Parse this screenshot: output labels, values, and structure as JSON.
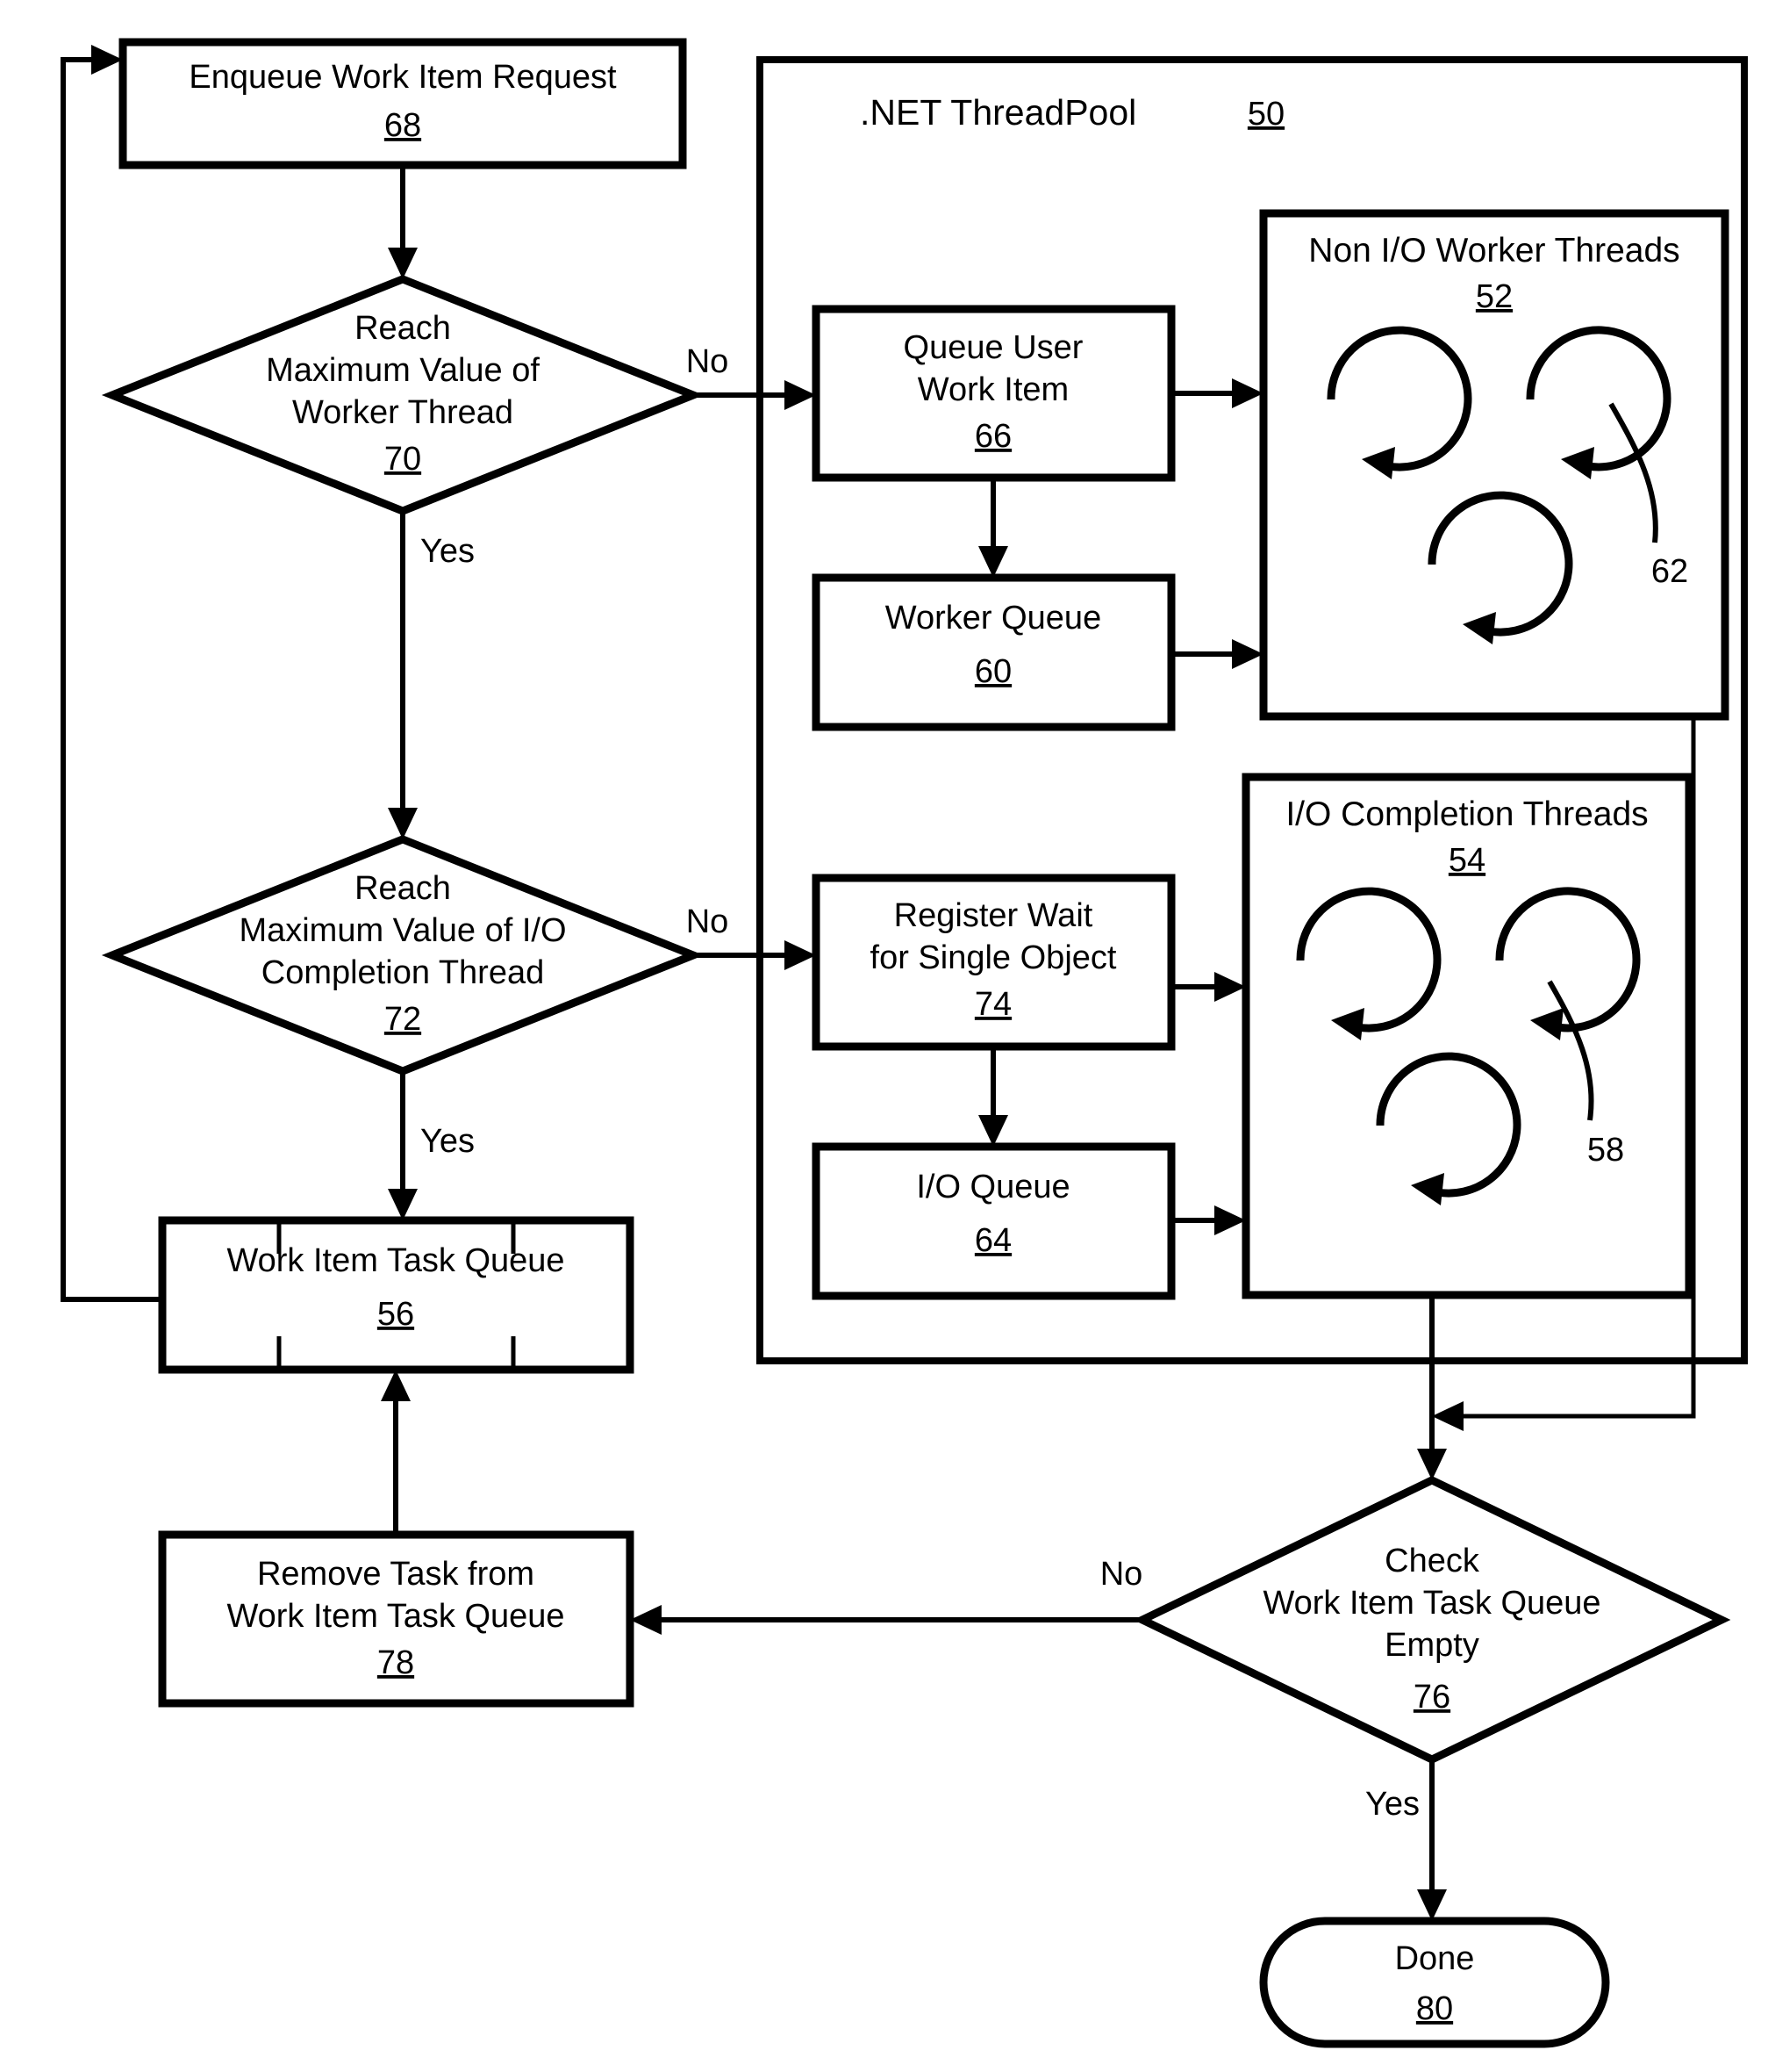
{
  "figure": {
    "kind": "patent-flowchart",
    "title": ".NET ThreadPool work item dispatch flow"
  },
  "container": {
    "label": ".NET ThreadPool",
    "ref": "50"
  },
  "nodes": {
    "enqueue": {
      "line1": "Enqueue Work Item Request",
      "ref": "68"
    },
    "decision_worker": {
      "line1": "Reach",
      "line2": "Maximum Value of",
      "line3": "Worker Thread",
      "ref": "70"
    },
    "decision_io": {
      "line1": "Reach",
      "line2": "Maximum Value of I/O",
      "line3": "Completion Thread",
      "ref": "72"
    },
    "queue_user_work_item": {
      "line1": "Queue User",
      "line2": "Work Item",
      "ref": "66"
    },
    "worker_queue": {
      "line1": "Worker Queue",
      "ref": "60"
    },
    "register_wait": {
      "line1": "Register Wait",
      "line2": "for Single Object",
      "ref": "74"
    },
    "io_queue": {
      "line1": "I/O Queue",
      "ref": "64"
    },
    "non_io_worker_threads": {
      "line1": "Non I/O Worker Threads",
      "ref": "52",
      "thread_ref": "62"
    },
    "io_completion_threads": {
      "line1": "I/O Completion Threads",
      "ref": "54",
      "thread_ref": "58"
    },
    "work_item_task_queue": {
      "line1": "Work Item Task Queue",
      "ref": "56"
    },
    "remove_task": {
      "line1": "Remove Task from",
      "line2": "Work Item Task Queue",
      "ref": "78"
    },
    "decision_check_empty": {
      "line1": "Check",
      "line2": "Work Item Task Queue",
      "line3": "Empty",
      "ref": "76"
    },
    "done": {
      "line1": "Done",
      "ref": "80"
    }
  },
  "branch_labels": {
    "worker_no": "No",
    "worker_yes": "Yes",
    "io_no": "No",
    "io_yes": "Yes",
    "check_no": "No",
    "check_yes": "Yes"
  },
  "colors": {
    "stroke": "#000000",
    "fill": "#ffffff",
    "background": "#ffffff"
  }
}
